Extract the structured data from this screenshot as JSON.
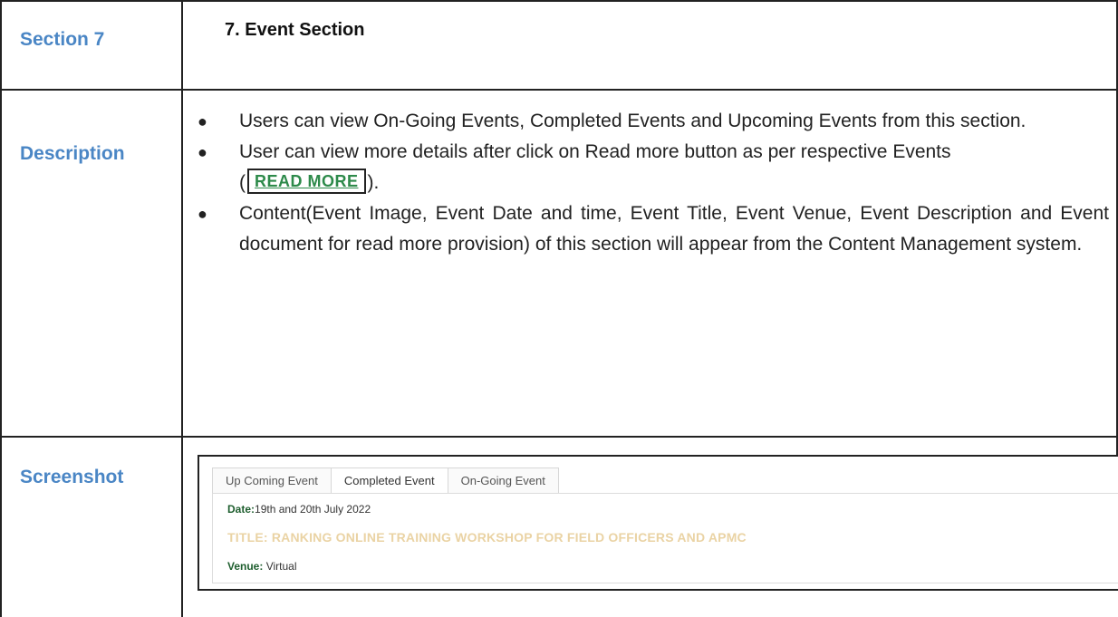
{
  "rows": {
    "section": {
      "label": "Section 7",
      "value": "7.  Event Section"
    },
    "description": {
      "label": "Description",
      "bullet_glyph": "●",
      "bullet1": "Users can view On-Going Events, Completed Events and Upcoming Events from this section.",
      "bullet2_text": "User can view more details after click on Read more button as per respective Events",
      "bullet2_open": "(",
      "bullet2_button": "READ MORE",
      "bullet2_close": ").",
      "bullet3": "Content(Event Image, Event Date and time, Event Title, Event Venue, Event Description and Event document for read more provision) of this section will appear from the Content Management system."
    },
    "screenshot": {
      "label": "Screenshot"
    }
  },
  "screenshot": {
    "tabs": [
      "Up Coming Event",
      "Completed Event",
      "On-Going Event"
    ],
    "active_tab": "Completed Event",
    "event": {
      "date_label": "Date:",
      "date_value": "19th and 20th July 2022",
      "title": "TITLE: RANKING ONLINE TRAINING WORKSHOP FOR FIELD OFFICERS AND APMC",
      "venue_label": "Venue:",
      "venue_value": " Virtual"
    }
  },
  "colors": {
    "label": "#4a86c5",
    "read_more": "#2d8a4a",
    "event_title": "#ead3a4",
    "date_label": "#1e5e2e"
  }
}
